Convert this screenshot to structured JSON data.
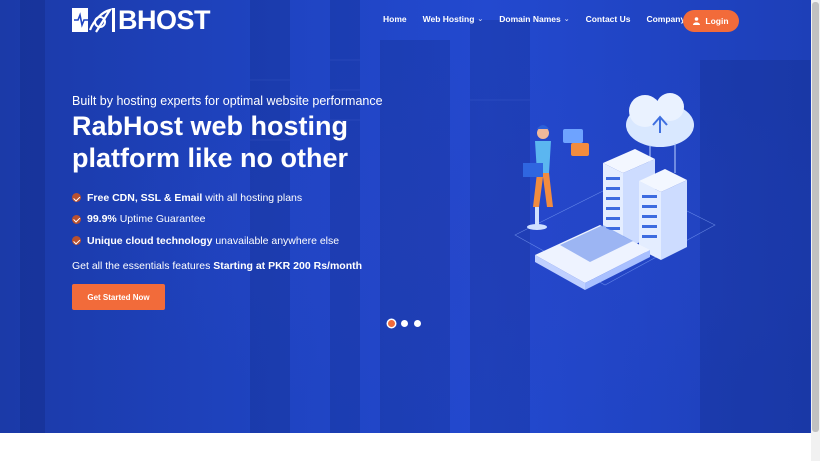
{
  "brand": {
    "logo_text": "BHOST",
    "accent": "#f26b3a",
    "hero_blue": "#1f44c2"
  },
  "nav": {
    "items": [
      {
        "label": "Home",
        "has_dropdown": false
      },
      {
        "label": "Web Hosting",
        "has_dropdown": true
      },
      {
        "label": "Domain Names",
        "has_dropdown": true
      },
      {
        "label": "Contact Us",
        "has_dropdown": false
      },
      {
        "label": "Company",
        "has_dropdown": true
      }
    ],
    "login_label": "Login",
    "login_icon": "user-icon",
    "dropdown_icon": "chevron-down-icon"
  },
  "hero": {
    "eyebrow": "Built by hosting experts for optimal website performance",
    "headline": "RabHost web hosting platform like no other",
    "features": [
      {
        "bold": "Free CDN, SSL & Email",
        "rest": " with all hosting plans"
      },
      {
        "bold": "99.9%",
        "rest": " Uptime Guarantee"
      },
      {
        "bold": "Unique cloud technology",
        "rest": " unavailable anywhere else"
      }
    ],
    "pricing_prefix": "Get all the essentials features ",
    "pricing_bold": "Starting at PKR 200 Rs/month",
    "cta_label": "Get Started Now"
  },
  "carousel": {
    "slide_count": 3,
    "active_index": 0
  }
}
